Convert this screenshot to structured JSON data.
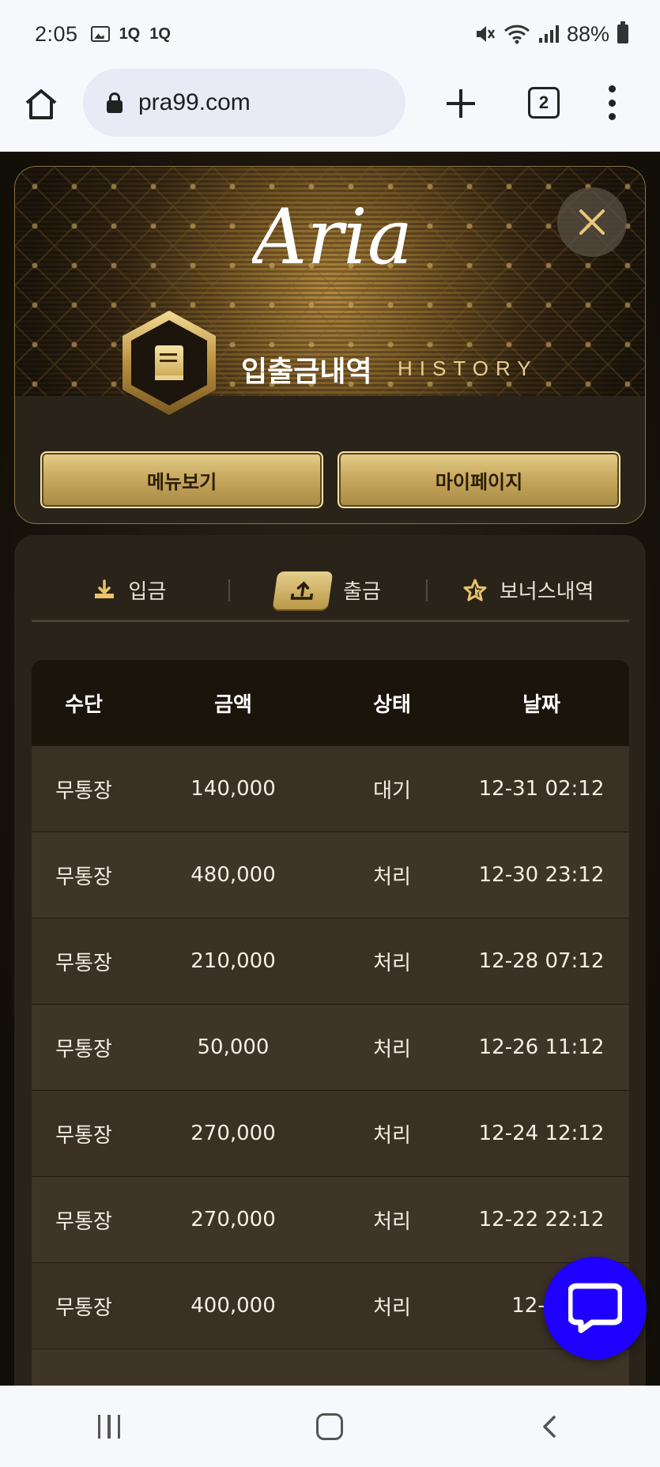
{
  "status_bar": {
    "time": "2:05",
    "left_icons": [
      "image-icon",
      "1q-icon",
      "1q-icon"
    ],
    "right_icons": [
      "mute-icon",
      "wifi-icon",
      "signal-icon"
    ],
    "battery": "88%"
  },
  "browser": {
    "url": "pra99.com",
    "tab_count": "2"
  },
  "header": {
    "logo": "Aria",
    "title_ko": "입출금내역",
    "title_en": "HISTORY",
    "buttons": {
      "menu": "메뉴보기",
      "mypage": "마이페이지"
    }
  },
  "tabs": [
    {
      "label": "입금",
      "icon": "download-icon",
      "active": false
    },
    {
      "label": "출금",
      "icon": "upload-icon",
      "active": true
    },
    {
      "label": "보너스내역",
      "icon": "star-icon",
      "active": false
    }
  ],
  "table": {
    "headers": [
      "수단",
      "금액",
      "상태",
      "날짜"
    ],
    "rows": [
      {
        "method": "무통장",
        "amount": "140,000",
        "status": "대기",
        "date": "12-31 02:12"
      },
      {
        "method": "무통장",
        "amount": "480,000",
        "status": "처리",
        "date": "12-30 23:12"
      },
      {
        "method": "무통장",
        "amount": "210,000",
        "status": "처리",
        "date": "12-28 07:12"
      },
      {
        "method": "무통장",
        "amount": "50,000",
        "status": "처리",
        "date": "12-26 11:12"
      },
      {
        "method": "무통장",
        "amount": "270,000",
        "status": "처리",
        "date": "12-24 12:12"
      },
      {
        "method": "무통장",
        "amount": "270,000",
        "status": "처리",
        "date": "12-22 22:12"
      },
      {
        "method": "무통장",
        "amount": "400,000",
        "status": "처리",
        "date": "12-22"
      }
    ]
  },
  "colors": {
    "gold": "#c9a95e",
    "card_bg": "#2a2319",
    "chat_fab": "#1f00ff"
  }
}
